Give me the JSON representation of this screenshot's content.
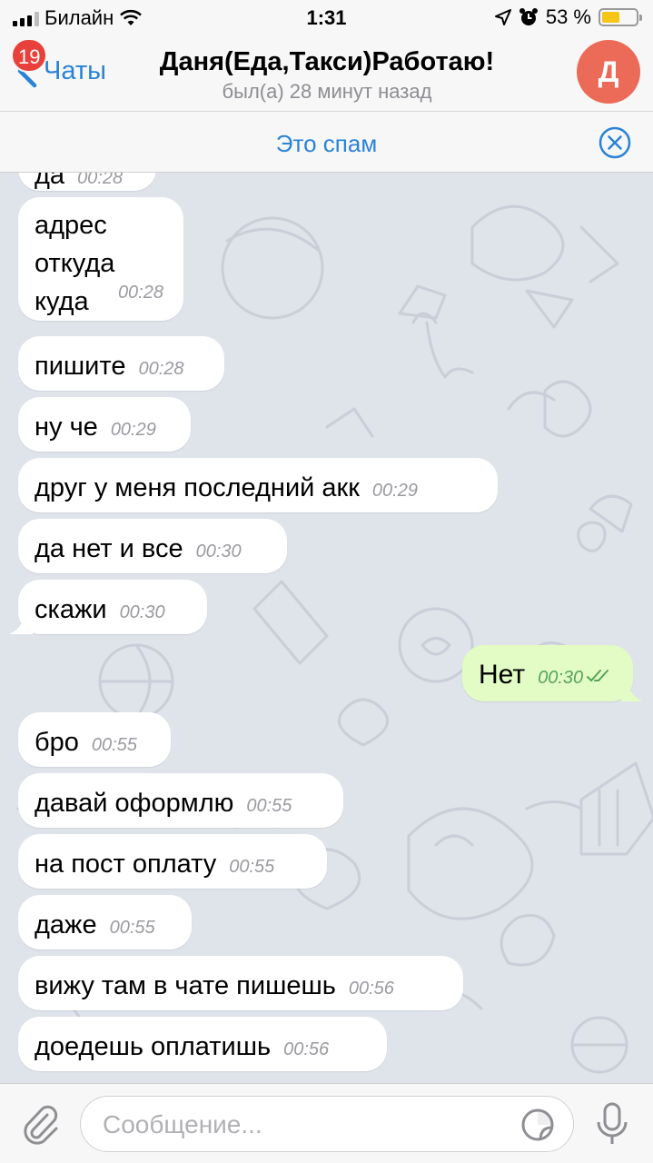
{
  "status_bar": {
    "carrier": "Билайн",
    "time": "1:31",
    "battery": "53 %",
    "battery_level": 0.53
  },
  "navbar": {
    "back_label": "Чаты",
    "unread_badge": "19",
    "title": "Даня(Еда,Такси)Работаю!",
    "subtitle": "был(а) 28 минут назад",
    "avatar_letter": "Д",
    "avatar_color": "#ec6a58"
  },
  "spam_bar": {
    "label": "Это спам"
  },
  "messages": [
    {
      "text": "да",
      "time": "00:28",
      "direction": "in"
    },
    {
      "text": "адрес\nоткуда\nкуда",
      "time": "00:28",
      "direction": "in"
    },
    {
      "text": "пишите",
      "time": "00:28",
      "direction": "in"
    },
    {
      "text": "ну че",
      "time": "00:29",
      "direction": "in"
    },
    {
      "text": "друг у меня последний акк",
      "time": "00:29",
      "direction": "in"
    },
    {
      "text": "да нет и все",
      "time": "00:30",
      "direction": "in"
    },
    {
      "text": "скажи",
      "time": "00:30",
      "direction": "in"
    },
    {
      "text": "Нет",
      "time": "00:30",
      "direction": "out",
      "read": true
    },
    {
      "text": "бро",
      "time": "00:55",
      "direction": "in"
    },
    {
      "text": "давай оформлю",
      "time": "00:55",
      "direction": "in"
    },
    {
      "text": "на пост оплату",
      "time": "00:55",
      "direction": "in"
    },
    {
      "text": "даже",
      "time": "00:55",
      "direction": "in"
    },
    {
      "text": "вижу там в чате пишешь",
      "time": "00:56",
      "direction": "in"
    },
    {
      "text": "доедешь оплатишь",
      "time": "00:56",
      "direction": "in"
    }
  ],
  "composer": {
    "placeholder": "Сообщение..."
  },
  "colors": {
    "accent": "#2a83d6",
    "badge": "#e8413c",
    "outgoing_bubble": "#e3fcc5",
    "chat_background": "#dfe3ea"
  }
}
